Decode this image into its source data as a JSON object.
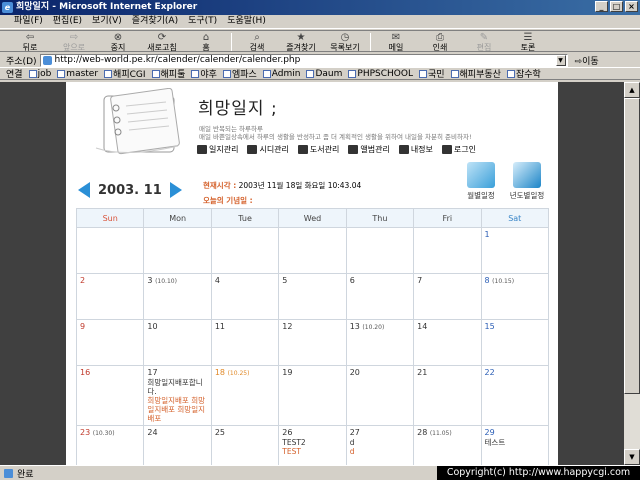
{
  "window": {
    "title": "희망일지 - Microsoft Internet Explorer",
    "min": "_",
    "max": "□",
    "close": "×"
  },
  "menu": [
    "파일(F)",
    "편집(E)",
    "보기(V)",
    "즐겨찾기(A)",
    "도구(T)",
    "도움말(H)"
  ],
  "toolbar": {
    "back": "뒤로",
    "forward": "앞으로",
    "stop": "중지",
    "refresh": "새로고침",
    "home": "홈",
    "search": "검색",
    "favorites": "즐겨찾기",
    "history": "목록보기",
    "mail": "메일",
    "print": "인쇄",
    "edit": "편집",
    "discuss": "토론"
  },
  "address": {
    "label": "주소(D)",
    "url": "http://web-world.pe.kr/calender/calender/calender.php",
    "go": "이동"
  },
  "links": {
    "label": "연결",
    "items": [
      "job",
      "master",
      "해피CGI",
      "해피툴",
      "야후",
      "엠파스",
      "Admin",
      "Daum",
      "PHPSCHOOL",
      "국민",
      "해피부동산",
      "잡수학"
    ]
  },
  "status": {
    "text": "완료",
    "copyright": "Copyright(c) http://www.happycgi.com"
  },
  "page": {
    "title": "희망일지 ;",
    "subtitle1": "매일 반복되는 하루하루",
    "subtitle2": "매일 바쁜일상속에서 하루의 생활을 반성하고 좀 더 계획적인 생활을 위하여 내일을 차분히 준비하자!",
    "nav": [
      "일지관리",
      "시디관리",
      "도서관리",
      "앨범관리",
      "내정보",
      "로그인"
    ],
    "month": "2003. 11",
    "now_label": "현재시각 :",
    "now_value": "2003년 11월 18일  화요일   10:43.04",
    "memo_label": "오늘의 기념일 :",
    "monthly": "월별일정",
    "yearly": "년도별일정"
  },
  "calendar": {
    "weekdays": [
      "Sun",
      "Mon",
      "Tue",
      "Wed",
      "Thu",
      "Fri",
      "Sat"
    ],
    "weeks": [
      [
        {
          "d": ""
        },
        {
          "d": ""
        },
        {
          "d": ""
        },
        {
          "d": ""
        },
        {
          "d": ""
        },
        {
          "d": ""
        },
        {
          "d": "1"
        }
      ],
      [
        {
          "d": "2"
        },
        {
          "d": "3",
          "l": "(10.10)"
        },
        {
          "d": "4"
        },
        {
          "d": "5"
        },
        {
          "d": "6"
        },
        {
          "d": "7"
        },
        {
          "d": "8",
          "l": "(10.15)"
        }
      ],
      [
        {
          "d": "9"
        },
        {
          "d": "10"
        },
        {
          "d": "11"
        },
        {
          "d": "12"
        },
        {
          "d": "13",
          "l": "(10.20)"
        },
        {
          "d": "14"
        },
        {
          "d": "15"
        }
      ],
      [
        {
          "d": "16"
        },
        {
          "d": "17",
          "e": [
            "희망일지배포합니다."
          ],
          "eo": [
            "희망일지배포 희망일지배포 희망일지배포"
          ]
        },
        {
          "d": "18",
          "l": "(10.25)",
          "h": true
        },
        {
          "d": "19"
        },
        {
          "d": "20"
        },
        {
          "d": "21"
        },
        {
          "d": "22"
        }
      ],
      [
        {
          "d": "23",
          "l": "(10.30)"
        },
        {
          "d": "24"
        },
        {
          "d": "25"
        },
        {
          "d": "26",
          "e": [
            "TEST2"
          ],
          "eo": [
            "TEST"
          ]
        },
        {
          "d": "27",
          "e": [
            "d"
          ],
          "eo": [
            "d"
          ]
        },
        {
          "d": "28",
          "l": "(11.05)"
        },
        {
          "d": "29",
          "e": [
            "테스트"
          ]
        }
      ]
    ]
  }
}
